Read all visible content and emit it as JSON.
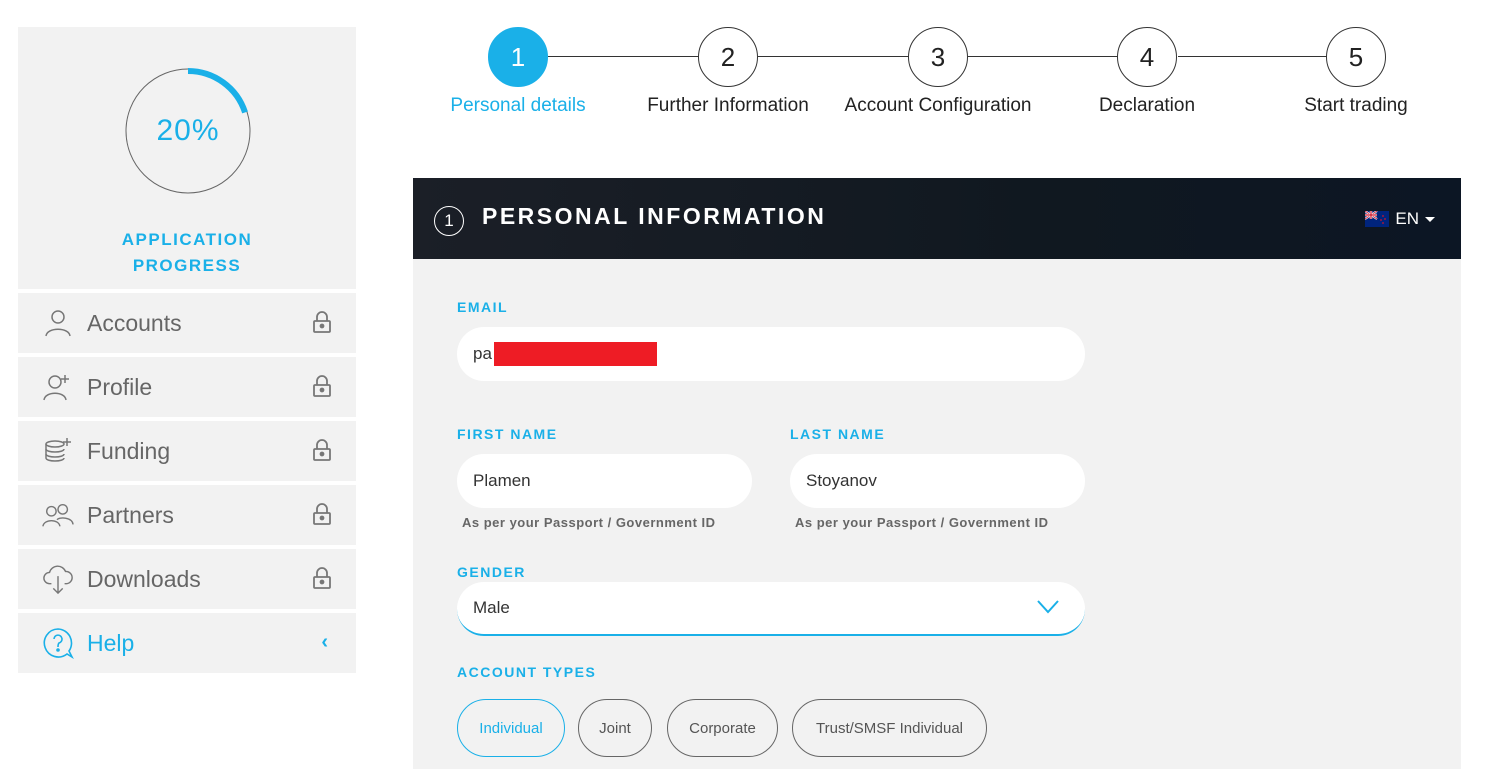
{
  "progress": {
    "percent_text": "20%",
    "fraction": 0.2,
    "title_line1": "APPLICATION",
    "title_line2": "PROGRESS"
  },
  "nav": [
    {
      "label": "Accounts",
      "icon": "user-icon",
      "locked": true
    },
    {
      "label": "Profile",
      "icon": "user-plus-icon",
      "locked": true
    },
    {
      "label": "Funding",
      "icon": "coins-plus-icon",
      "locked": true
    },
    {
      "label": "Partners",
      "icon": "users-icon",
      "locked": true
    },
    {
      "label": "Downloads",
      "icon": "cloud-download-icon",
      "locked": true
    },
    {
      "label": "Help",
      "icon": "help-chat-icon",
      "locked": false
    }
  ],
  "steps": [
    {
      "number": "1",
      "label": "Personal details",
      "active": true
    },
    {
      "number": "2",
      "label": "Further Information",
      "active": false
    },
    {
      "number": "3",
      "label": "Account Configuration",
      "active": false
    },
    {
      "number": "4",
      "label": "Declaration",
      "active": false
    },
    {
      "number": "5",
      "label": "Start trading",
      "active": false
    }
  ],
  "section": {
    "number": "1",
    "title": "PERSONAL INFORMATION",
    "language": "EN"
  },
  "form": {
    "email_label": "EMAIL",
    "email_value": "pa",
    "first_name_label": "FIRST NAME",
    "first_name_value": "Plamen",
    "first_name_hint": "As per your Passport / Government ID",
    "last_name_label": "LAST NAME",
    "last_name_value": "Stoyanov",
    "last_name_hint": "As per your Passport / Government ID",
    "gender_label": "GENDER",
    "gender_value": "Male",
    "account_types_label": "ACCOUNT TYPES",
    "account_types": [
      "Individual",
      "Joint",
      "Corporate",
      "Trust/SMSF Individual"
    ],
    "account_type_selected": "Individual"
  },
  "colors": {
    "accent": "#1ab0e8",
    "header_bg": "#101820",
    "panel_bg": "#f2f2f2",
    "redaction": "#ee1c25"
  }
}
